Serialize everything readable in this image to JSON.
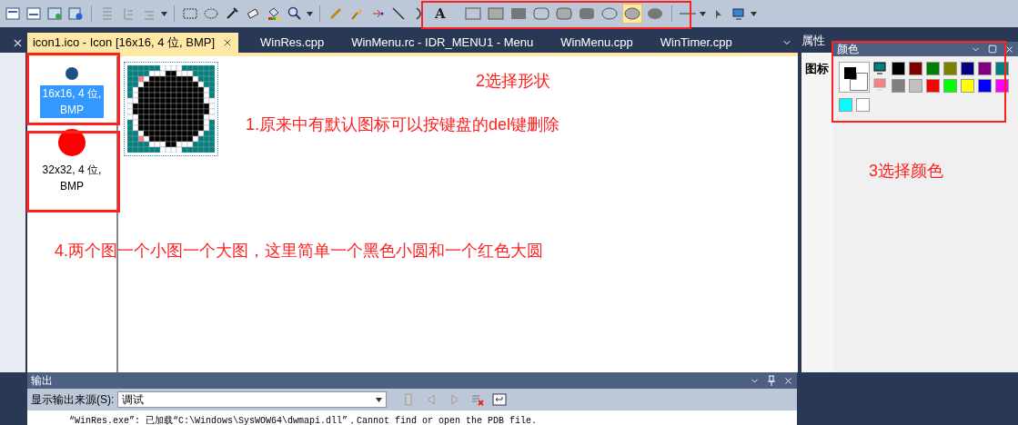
{
  "toolbar": {
    "text_tool": "A",
    "shape_tools": [
      {
        "kind": "rect-outline",
        "selected": false
      },
      {
        "kind": "rect-filled-outline",
        "selected": false
      },
      {
        "kind": "rect-filled",
        "selected": false
      },
      {
        "kind": "round-outline",
        "selected": false
      },
      {
        "kind": "round-filled-outline",
        "selected": false
      },
      {
        "kind": "round-filled",
        "selected": false
      },
      {
        "kind": "ellipse-outline",
        "selected": false
      },
      {
        "kind": "ellipse-filled-outline",
        "selected": true
      },
      {
        "kind": "ellipse-filled",
        "selected": false
      }
    ]
  },
  "tabs": [
    {
      "label": "icon1.ico - Icon [16x16, 4 位, BMP]",
      "selected": true
    },
    {
      "label": "WinRes.cpp",
      "selected": false
    },
    {
      "label": "WinMenu.rc - IDR_MENU1 - Menu",
      "selected": false
    },
    {
      "label": "WinMenu.cpp",
      "selected": false
    },
    {
      "label": "WinTimer.cpp",
      "selected": false
    }
  ],
  "image_types": [
    {
      "label": "16x16, 4 位, BMP",
      "selected": true,
      "color": "#1f4e82",
      "kind": "small"
    },
    {
      "label": "32x32, 4 位, BMP",
      "selected": false,
      "color": "#ff0000",
      "kind": "large"
    }
  ],
  "properties": {
    "title": "属性",
    "field": "图标"
  },
  "colors_panel": {
    "title": "颜色",
    "foreground": {
      "color": "#000000"
    },
    "background": {
      "color": "#ffffff"
    },
    "swatches": [
      {
        "color": "#000000"
      },
      {
        "color": "#800000"
      },
      {
        "color": "#008000"
      },
      {
        "color": "#808000"
      },
      {
        "color": "#000080"
      },
      {
        "color": "#800080"
      },
      {
        "color": "#008080"
      },
      {
        "color": "#808080"
      },
      {
        "color": "#c0c0c0"
      },
      {
        "color": "#ff0000"
      },
      {
        "color": "#00ff00"
      },
      {
        "color": "#ffff00"
      },
      {
        "color": "#0000ff"
      },
      {
        "color": "#ff00ff"
      },
      {
        "color": "#00ffff"
      },
      {
        "color": "#ffffff"
      }
    ]
  },
  "output": {
    "title": "输出",
    "source_label": "显示输出来源(S):",
    "source_value": "调试",
    "line": "“WinRes.exe”: 已加载“C:\\Windows\\SysWOW64\\dwmapi.dll”，Cannot find or open the PDB file."
  },
  "annotations": [
    {
      "text": "2选择形状"
    },
    {
      "text": "1.原来中有默认图标可以按键盘的del键删除"
    },
    {
      "text": "3选择颜色"
    },
    {
      "text": "4.两个图一个小图一个大图，这里简单一个黑色小圆和一个红色大圆"
    }
  ]
}
